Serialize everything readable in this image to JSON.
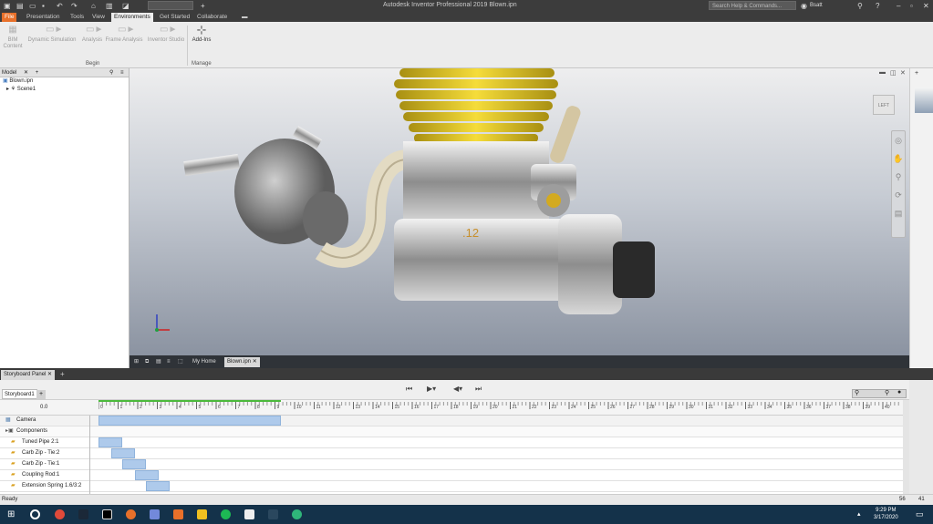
{
  "title": {
    "text": "Autodesk Inventor Professional 2019   Blown.ipn",
    "search_placeholder": "Search Help & Commands...",
    "user": "Bsatt"
  },
  "menu": {
    "file": "File",
    "tabs": [
      "Presentation",
      "Tools",
      "View",
      "Environments",
      "Get Started",
      "Collaborate"
    ]
  },
  "ribbon": {
    "buttons": [
      {
        "label": "BIM Content",
        "icon": "bim-icon"
      },
      {
        "label": "Dynamic Simulation",
        "icon": "simulation-icon"
      },
      {
        "label": "Analysis",
        "icon": "analysis-icon"
      },
      {
        "label": "Frame Analysis",
        "icon": "frame-analysis-icon"
      },
      {
        "label": "Inventor Studio",
        "icon": "studio-icon"
      },
      {
        "label": "Add-Ins",
        "icon": "add-ins-icon"
      }
    ],
    "panels": [
      "Begin",
      "Manage"
    ]
  },
  "model": {
    "tab": "Model",
    "items": [
      "Blown.ipn",
      "Scene1"
    ]
  },
  "viewport": {
    "engine_label": ".12",
    "viewcube_label": "LEFT"
  },
  "doc_tabs": [
    "My Home",
    "Blown.ipn"
  ],
  "storyboard": {
    "panel_title": "Storyboard Panel",
    "tab": "Storyboard1",
    "time": "0.0",
    "rows": [
      "Camera",
      "Components",
      "Tuned Pipe 2:1",
      "Carb Zip - Tie:2",
      "Carb Zip - Tie:1",
      "Coupling Rod:1",
      "Extension Spring 1.6/3:2"
    ],
    "ticks": [
      "0",
      "1",
      "2",
      "3",
      "4",
      "5",
      "6",
      "7",
      "8",
      "9",
      "10",
      "11",
      "12",
      "13",
      "14",
      "15",
      "16",
      "17",
      "18",
      "19",
      "20",
      "21",
      "22",
      "23",
      "24",
      "25",
      "26",
      "27",
      "28",
      "29",
      "30",
      "31",
      "32",
      "33",
      "34",
      "35",
      "36",
      "37",
      "38",
      "39",
      "40"
    ]
  },
  "status": {
    "text": "Ready",
    "num1": "56",
    "num2": "41"
  },
  "clock": {
    "time": "9:29 PM",
    "date": "3/17/2020"
  }
}
